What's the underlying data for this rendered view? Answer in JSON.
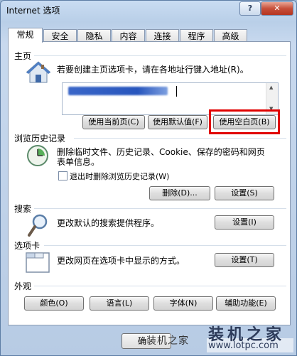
{
  "window": {
    "title": "Internet 选项",
    "help_label": "?",
    "close_label": "✕"
  },
  "tabs": [
    {
      "label": "常规"
    },
    {
      "label": "安全"
    },
    {
      "label": "隐私"
    },
    {
      "label": "内容"
    },
    {
      "label": "连接"
    },
    {
      "label": "程序"
    },
    {
      "label": "高级"
    }
  ],
  "home": {
    "section_title": "主页",
    "description": "若要创建主页选项卡，请在各地址行键入地址(R)。",
    "use_current_label": "使用当前页(C)",
    "use_default_label": "使用默认值(F)",
    "use_blank_label": "使用空白页(B)"
  },
  "history": {
    "section_title": "浏览历史记录",
    "description_line1": "删除临时文件、历史记录、Cookie、保存的密码和网页",
    "description_line2": "表单信息。",
    "checkbox_label": "退出时删除浏览历史记录(W)",
    "delete_label": "删除(D)...",
    "settings_label": "设置(S)"
  },
  "search": {
    "section_title": "搜索",
    "description": "更改默认的搜索提供程序。",
    "settings_label": "设置(I)"
  },
  "tabs_section": {
    "section_title": "选项卡",
    "description": "更改网页在选项卡中显示的方式。",
    "settings_label": "设置(T)"
  },
  "appearance": {
    "section_title": "外观",
    "colors_label": "颜色(O)",
    "languages_label": "语言(L)",
    "fonts_label": "字体(N)",
    "accessibility_label": "辅助功能(E)"
  },
  "footer": {
    "ok_label": "确",
    "watermark_text": "装机之家",
    "watermark_big": "装机之家",
    "watermark_url": "www.lotpc.com"
  }
}
